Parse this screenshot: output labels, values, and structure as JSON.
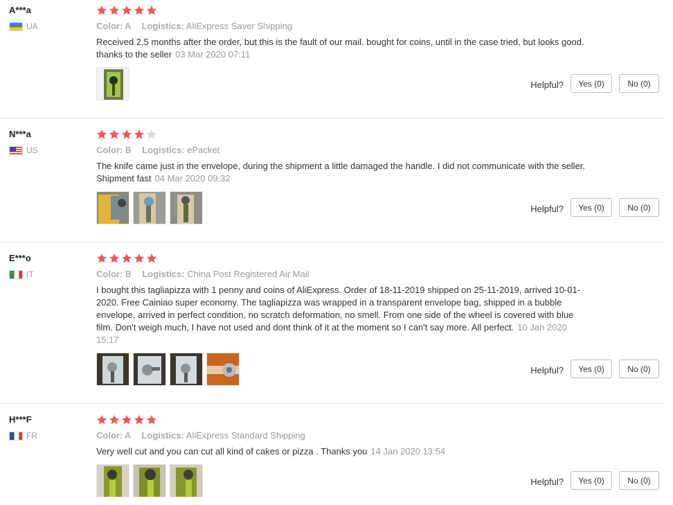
{
  "colors": {
    "star": "#f55355",
    "star_empty": "#d9d9d9",
    "meta": "#999999"
  },
  "labels": {
    "color": "Color:",
    "logistics": "Logistics:",
    "helpful": "Helpful?"
  },
  "reviews": [
    {
      "user": "A***a",
      "country": "UA",
      "flag": "ua",
      "rating": 5,
      "color": "A",
      "logistics": "AliExpress Saver Shipping",
      "text": "Received 2,5 months after the order, but this is the fault of our mail. bought for coins, until in the case tried, but looks good. thanks to the seller",
      "date": "03 Mar 2020 07:11",
      "photos": [
        "green-knife-photo"
      ],
      "yes": "Yes (0)",
      "no": "No (0)"
    },
    {
      "user": "N***a",
      "country": "US",
      "flag": "us",
      "rating": 4,
      "color": "B",
      "logistics": "ePacket",
      "text": "The knife came just in the envelope, during the shipment a little damaged the handle. I did not communicate with the seller. Shipment fast",
      "date": "04 Mar 2020 09:32",
      "photos": [
        "envelope-photo",
        "knife-hand-photo",
        "knife-hand-photo-2"
      ],
      "yes": "Yes (0)",
      "no": "No (0)"
    },
    {
      "user": "E***o",
      "country": "IT",
      "flag": "it",
      "rating": 5,
      "color": "B",
      "logistics": "China Post Registered Air Mail",
      "text": "I bought this tagliapizza with 1 penny and coins of AliExpress. Order of 18-11-2019 shipped on 25-11-2019, arrived 10-01-2020. Free Cainiao super economy. The tagliapizza was wrapped in a transparent envelope bag, shipped in a bubble envelope, arrived in perfect condition, no scratch deformation, no smell. From one side of the wheel is covered with blue film. Don't weigh much, I have not used and dont think of it at the moment so I can't say more. All perfect.",
      "date": "10 Jan 2020 15:17",
      "photos": [
        "package-photo",
        "package-photo-2",
        "package-photo-3",
        "wheel-closeup-photo"
      ],
      "yes": "Yes (0)",
      "no": "No (0)"
    },
    {
      "user": "H***F",
      "country": "FR",
      "flag": "fr",
      "rating": 5,
      "color": "A",
      "logistics": "AliExpress Standard Shipping",
      "text": "Very well cut and you can cut all kind of cakes or pizza . Thanks you",
      "date": "14 Jan 2020 13:54",
      "photos": [
        "cutter-photo",
        "cutter-photo-2",
        "cutter-photo-3"
      ],
      "yes": "Yes (0)",
      "no": "No (0)"
    }
  ]
}
